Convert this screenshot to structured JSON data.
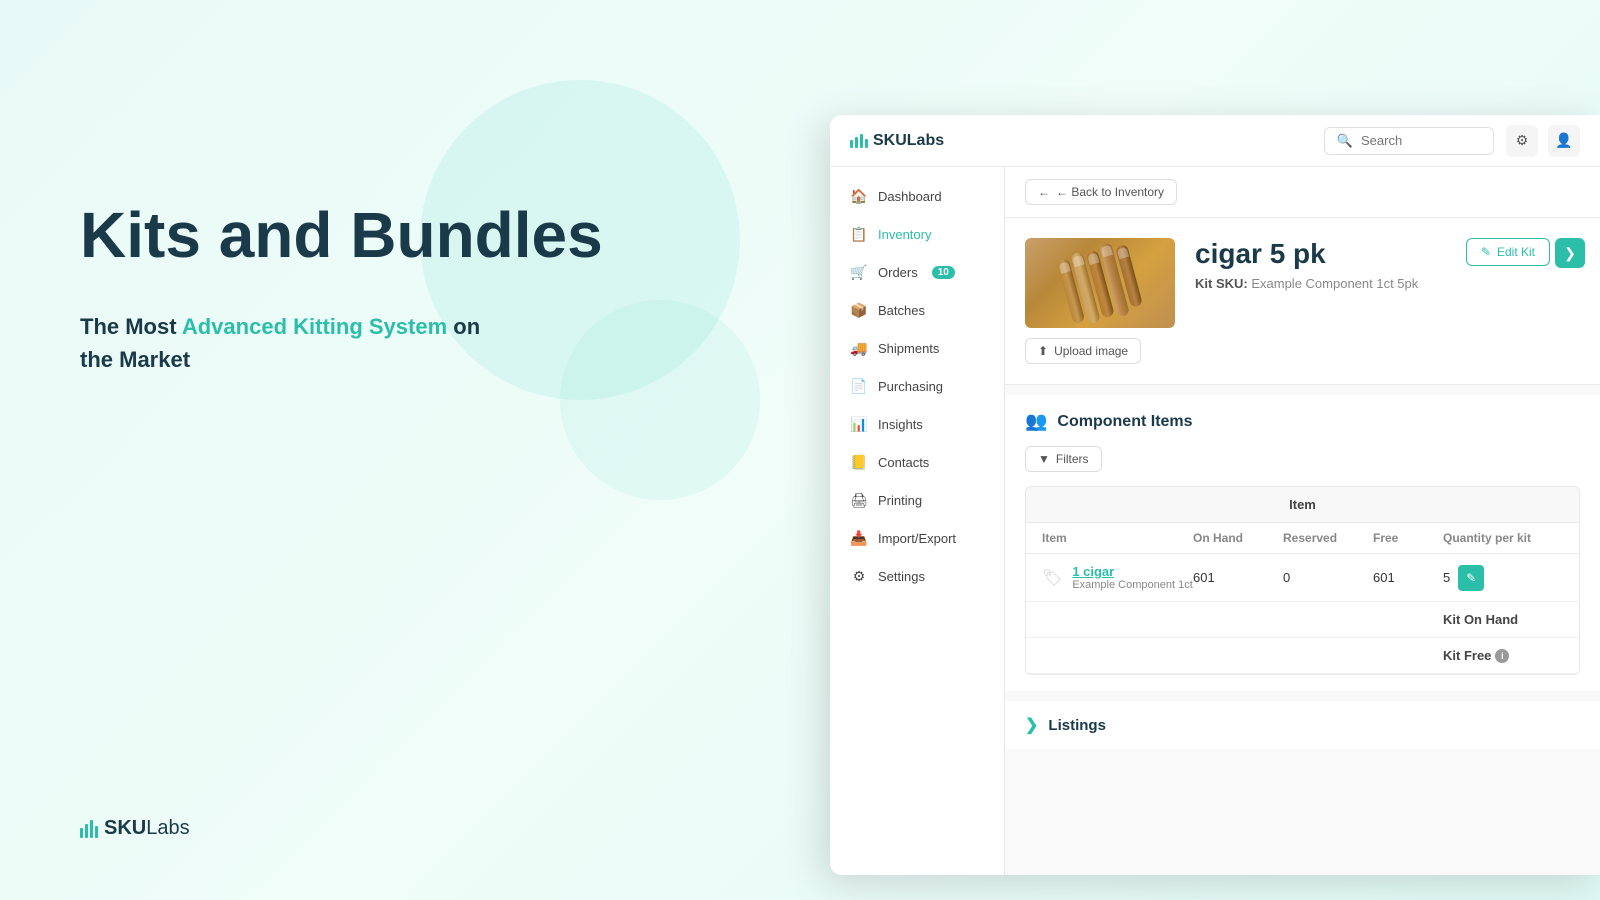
{
  "background": {
    "gradient_start": "#e8faf7",
    "gradient_end": "#e0f9f4"
  },
  "marketing": {
    "title": "Kits and Bundles",
    "subtitle_plain": "The Most ",
    "subtitle_highlight": "Advanced Kitting System",
    "subtitle_end": " on the Market"
  },
  "bottom_logo": {
    "text_bold": "SKU",
    "text_regular": "Labs"
  },
  "topbar": {
    "logo_bold": "SKU",
    "logo_regular": "Labs",
    "search_placeholder": "Search"
  },
  "sidebar": {
    "items": [
      {
        "id": "dashboard",
        "label": "Dashboard",
        "icon": "dashboard",
        "badge": null,
        "active": false
      },
      {
        "id": "inventory",
        "label": "Inventory",
        "icon": "inventory",
        "badge": null,
        "active": true
      },
      {
        "id": "orders",
        "label": "Orders",
        "icon": "orders",
        "badge": "10",
        "active": false
      },
      {
        "id": "batches",
        "label": "Batches",
        "icon": "batches",
        "badge": null,
        "active": false
      },
      {
        "id": "shipments",
        "label": "Shipments",
        "icon": "shipments",
        "badge": null,
        "active": false
      },
      {
        "id": "purchasing",
        "label": "Purchasing",
        "icon": "purchasing",
        "badge": null,
        "active": false
      },
      {
        "id": "insights",
        "label": "Insights",
        "icon": "insights",
        "badge": null,
        "active": false
      },
      {
        "id": "contacts",
        "label": "Contacts",
        "icon": "contacts",
        "badge": null,
        "active": false
      },
      {
        "id": "printing",
        "label": "Printing",
        "icon": "printing",
        "badge": null,
        "active": false
      },
      {
        "id": "import_export",
        "label": "Import/Export",
        "icon": "import",
        "badge": null,
        "active": false
      },
      {
        "id": "settings",
        "label": "Settings",
        "icon": "settings",
        "badge": null,
        "active": false
      }
    ]
  },
  "back_button": {
    "label": "← Back to Inventory"
  },
  "product": {
    "name": "cigar 5 pk",
    "sku_label": "Kit SKU:",
    "sku_value": "Example Component 1ct 5pk",
    "upload_image_label": "Upload image",
    "edit_kit_label": "✎ Edit Kit"
  },
  "component_items": {
    "section_title": "Component Items",
    "filters_label": "Filters",
    "table_group_header": "Item",
    "columns": [
      {
        "id": "item",
        "label": "Item"
      },
      {
        "id": "on_hand",
        "label": "On Hand"
      },
      {
        "id": "reserved",
        "label": "Reserved"
      },
      {
        "id": "free",
        "label": "Free"
      },
      {
        "id": "qty_per_kit",
        "label": "Quantity per kit"
      }
    ],
    "rows": [
      {
        "item_name": "1 cigar",
        "item_sub": "Example Component 1ct",
        "on_hand": "601",
        "reserved": "0",
        "free": "601",
        "qty_per_kit": "5"
      }
    ],
    "kit_on_hand_label": "Kit On Hand",
    "kit_free_label": "Kit Free"
  },
  "listings": {
    "label": "Listings"
  }
}
